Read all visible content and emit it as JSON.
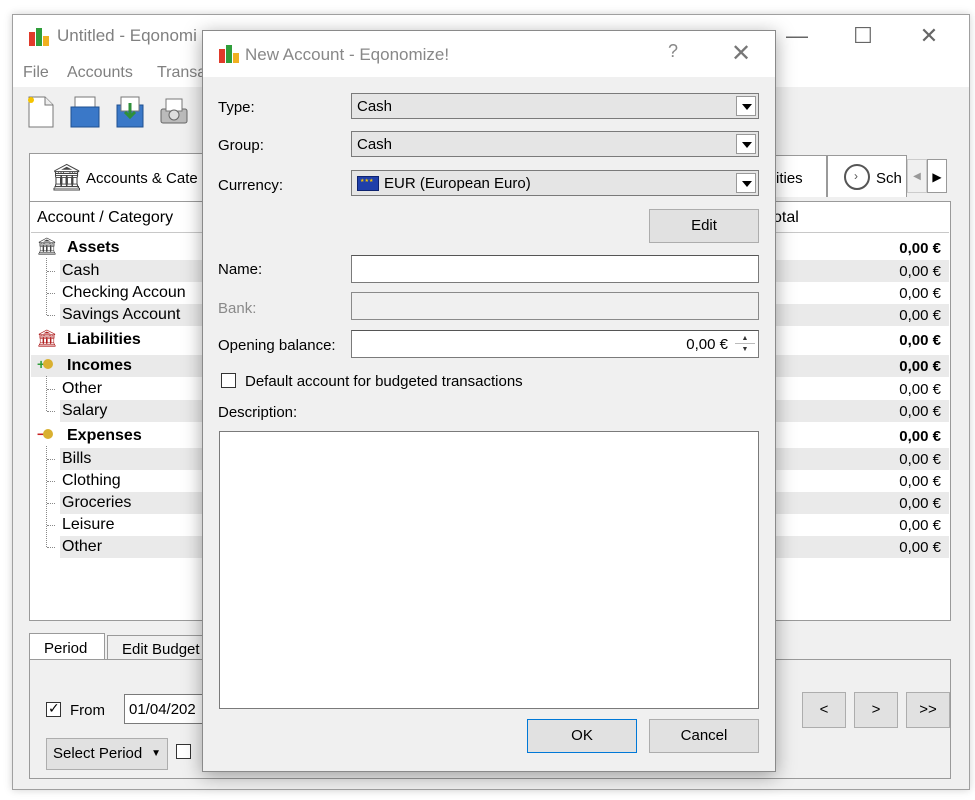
{
  "main_window": {
    "title": "Untitled - Eqonomi",
    "menu": [
      "File",
      "Accounts",
      "Transa"
    ],
    "tabs": {
      "accounts_categories": "Accounts & Cate",
      "securities": "ities",
      "schedule": "Sch"
    },
    "tree": {
      "header_account": "Account / Category",
      "header_total": "otal",
      "rows": [
        {
          "label": "Assets",
          "value": "0,00 €",
          "bold": true,
          "icon": "bank-icon"
        },
        {
          "label": "Cash",
          "value": "0,00 €"
        },
        {
          "label": "Checking Accoun",
          "value": "0,00 €"
        },
        {
          "label": "Savings Account",
          "value": "0,00 €"
        },
        {
          "label": "Liabilities",
          "value": "0,00 €",
          "bold": true,
          "icon": "liabilities-icon"
        },
        {
          "label": "Incomes",
          "value": "0,00 €",
          "bold": true,
          "icon": "incomes-icon"
        },
        {
          "label": "Other",
          "value": "0,00 €"
        },
        {
          "label": "Salary",
          "value": "0,00 €"
        },
        {
          "label": "Expenses",
          "value": "0,00 €",
          "bold": true,
          "icon": "expenses-icon"
        },
        {
          "label": "Bills",
          "value": "0,00 €"
        },
        {
          "label": "Clothing",
          "value": "0,00 €"
        },
        {
          "label": "Groceries",
          "value": "0,00 €"
        },
        {
          "label": "Leisure",
          "value": "0,00 €"
        },
        {
          "label": "Other",
          "value": "0,00 €"
        }
      ]
    },
    "bottom": {
      "tab_period": "Period",
      "tab_edit_budget": "Edit Budget",
      "from_label": "From",
      "from_value": "01/04/202",
      "select_period": "Select Period",
      "nav_prev": "<",
      "nav_next": ">",
      "nav_last": ">>"
    }
  },
  "dialog": {
    "title": "New Account - Eqonomize!",
    "help": "?",
    "close": "✕",
    "type_label": "Type:",
    "type_value": "Cash",
    "group_label": "Group:",
    "group_value": "Cash",
    "currency_label": "Currency:",
    "currency_value": "EUR (European Euro)",
    "edit_button": "Edit",
    "name_label": "Name:",
    "name_value": "",
    "bank_label": "Bank:",
    "bank_value": "",
    "opening_balance_label": "Opening balance:",
    "opening_balance_value": "0,00 €",
    "default_account_label": "Default account for budgeted transactions",
    "default_account_checked": false,
    "description_label": "Description:",
    "description_value": "",
    "ok_button": "OK",
    "cancel_button": "Cancel"
  },
  "colors": {
    "window_bg": "#f0f0f0",
    "row_alt": "#eaeaea",
    "eu_flag": "#1f3faa"
  }
}
